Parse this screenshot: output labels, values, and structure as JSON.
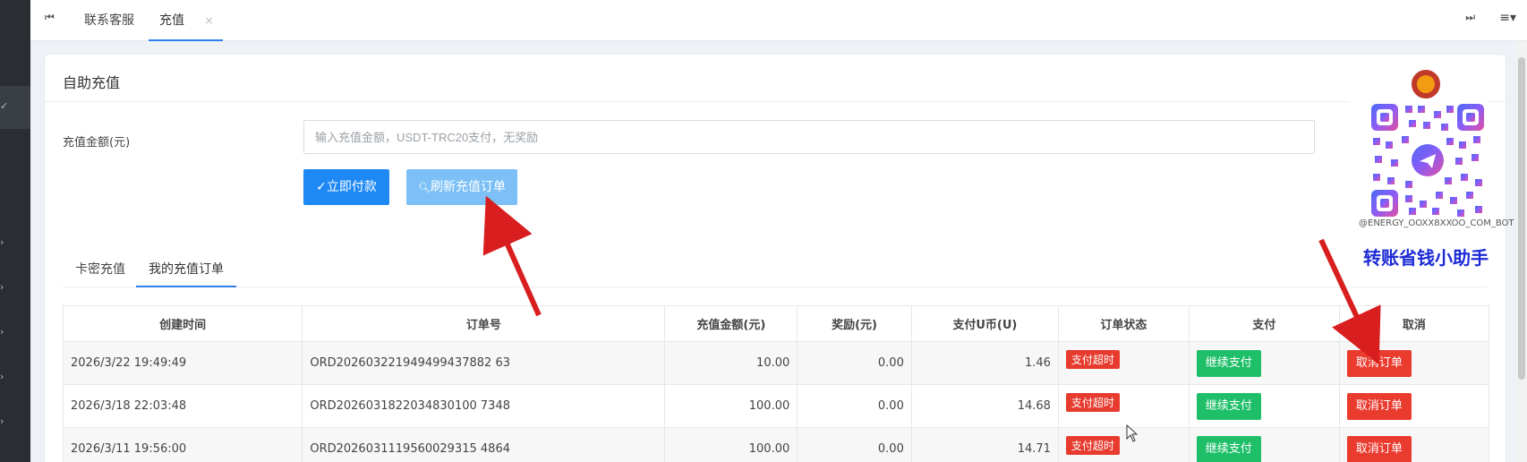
{
  "tabbar": {
    "tabs": [
      {
        "label": "联系客服"
      },
      {
        "label": "充值",
        "close": "×"
      }
    ],
    "first_icon": "skip-first-icon",
    "last_icon": "skip-last-icon",
    "menu_icon": "hamburger-menu-icon"
  },
  "card": {
    "title": "自助充值",
    "amount_label": "充值金额(元)",
    "amount_placeholder": "输入充值金额，USDT-TRC20支付，无奖励",
    "pay_button": "立即付款",
    "refresh_button": "刷新充值订单"
  },
  "subtabs": [
    "卡密充值",
    "我的充值订单"
  ],
  "table": {
    "headers": [
      "创建时间",
      "订单号",
      "充值金额(元)",
      "奖励(元)",
      "支付U币(U)",
      "订单状态",
      "支付",
      "取消"
    ],
    "rows": [
      {
        "time": "2026/3/22 19:49:49",
        "order": "ORD202603221949499437882 63",
        "amount": "10.00",
        "bonus": "0.00",
        "usdt": "1.46",
        "status": "支付超时",
        "pay": "继续支付",
        "cancel": "取消订单"
      },
      {
        "time": "2026/3/18 22:03:48",
        "order": "ORD2026031822034830100 7348",
        "amount": "100.00",
        "bonus": "0.00",
        "usdt": "14.68",
        "status": "支付超时",
        "pay": "继续支付",
        "cancel": "取消订单"
      },
      {
        "time": "2026/3/11 19:56:00",
        "order": "ORD2026031119560029315 4864",
        "amount": "100.00",
        "bonus": "0.00",
        "usdt": "14.71",
        "status": "支付超时",
        "pay": "继续支付",
        "cancel": "取消订单"
      }
    ]
  },
  "promo": {
    "handle": "@ENERGY_OOXX8XXOO_COM_BOT",
    "caption": "转账省钱小助手"
  },
  "colors": {
    "primary": "#1e88f5",
    "refresh": "#7cc0f7",
    "success": "#1fbf6a",
    "danger": "#ea3b2f",
    "amount_text": "#2e8b2e",
    "caption": "#1d2bd6",
    "arrow": "#d81e1e"
  }
}
